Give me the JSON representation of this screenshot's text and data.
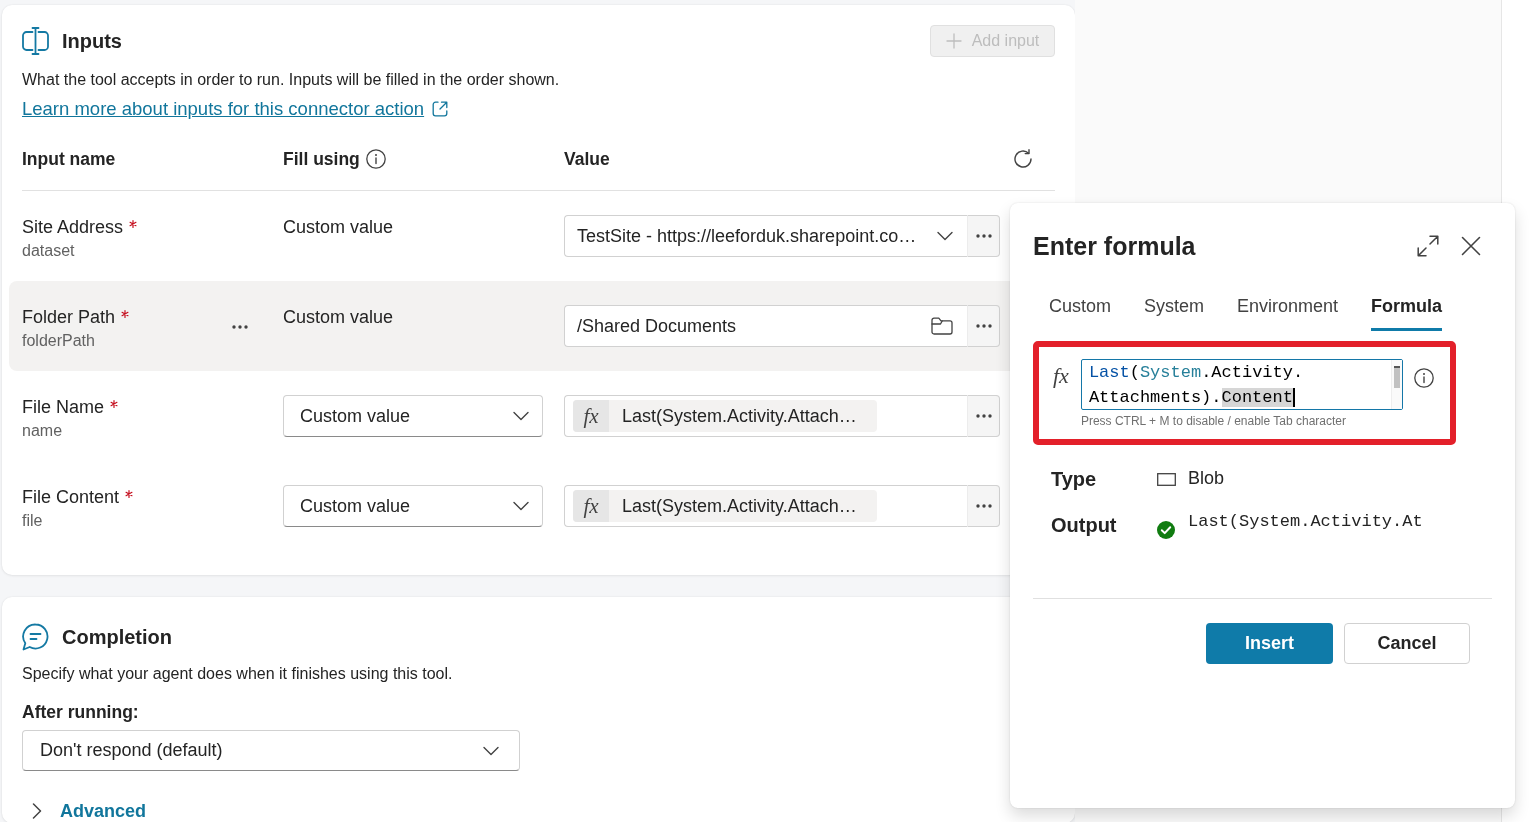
{
  "inputs_panel": {
    "title": "Inputs",
    "add_button": {
      "label": "Add input",
      "disabled": true
    },
    "description": "What the tool accepts in order to run. Inputs will be filled in the order shown.",
    "learn_more_link": "Learn more about inputs for this connector action",
    "columns": [
      "Input name",
      "Fill using",
      "Value"
    ],
    "rows": [
      {
        "name": "Site Address",
        "required": true,
        "parameter": "dataset",
        "hovered": false,
        "fill_using": {
          "kind": "text",
          "label": "Custom value"
        },
        "value": {
          "kind": "dropdown",
          "text": "TestSite - https://leeforduk.sharepoint.co…"
        }
      },
      {
        "name": "Folder Path",
        "required": true,
        "parameter": "folderPath",
        "hovered": true,
        "fill_using": {
          "kind": "text",
          "label": "Custom value"
        },
        "value": {
          "kind": "folder",
          "text": "/Shared Documents"
        }
      },
      {
        "name": "File Name",
        "required": true,
        "parameter": "name",
        "hovered": false,
        "fill_using": {
          "kind": "dropdown",
          "label": "Custom value"
        },
        "value": {
          "kind": "formula",
          "symbol": "fx",
          "text": "Last(System.Activity.Attach…"
        }
      },
      {
        "name": "File Content",
        "required": true,
        "parameter": "file",
        "hovered": false,
        "fill_using": {
          "kind": "dropdown",
          "label": "Custom value"
        },
        "value": {
          "kind": "formula",
          "symbol": "fx",
          "text": "Last(System.Activity.Attach…"
        }
      }
    ]
  },
  "completion_panel": {
    "title": "Completion",
    "description": "Specify what your agent does when it finishes using this tool.",
    "after_running": {
      "label": "After running:",
      "value": "Don't respond (default)"
    },
    "advanced": {
      "label": "Advanced",
      "expanded": false
    }
  },
  "formula_dialog": {
    "title": "Enter formula",
    "tabs": [
      {
        "label": "Custom",
        "selected": false
      },
      {
        "label": "System",
        "selected": false
      },
      {
        "label": "Environment",
        "selected": false
      },
      {
        "label": "Formula",
        "selected": true
      }
    ],
    "editor": {
      "symbol": "fx",
      "highlighted": true,
      "lines": [
        [
          {
            "text": "Last",
            "kind": "function"
          },
          {
            "text": "(",
            "kind": "plain"
          },
          {
            "text": "System",
            "kind": "identifier"
          },
          {
            "text": ".Activity.",
            "kind": "plain"
          }
        ],
        [
          {
            "text": "Attachments).",
            "kind": "plain"
          },
          {
            "text": "Content",
            "kind": "selection"
          }
        ]
      ],
      "hint": "Press CTRL + M to disable / enable Tab character"
    },
    "type": {
      "label": "Type",
      "value": "Blob"
    },
    "output": {
      "label": "Output",
      "valid": true,
      "value": "Last(System.Activity.At"
    },
    "buttons": [
      {
        "label": "Insert",
        "kind": "primary"
      },
      {
        "label": "Cancel",
        "kind": "secondary"
      }
    ]
  }
}
